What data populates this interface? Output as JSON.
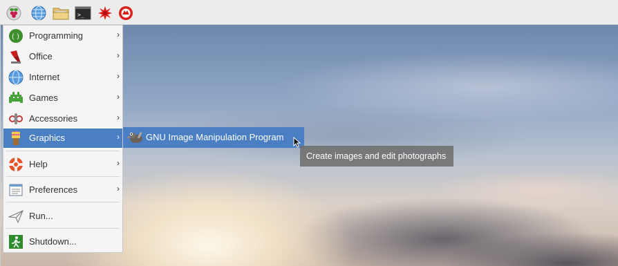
{
  "taskbar": {
    "icons": [
      {
        "name": "raspberry-menu-icon"
      },
      {
        "name": "web-browser-icon"
      },
      {
        "name": "file-manager-icon"
      },
      {
        "name": "terminal-icon"
      },
      {
        "name": "mathematica-icon"
      },
      {
        "name": "wolfram-icon"
      }
    ]
  },
  "menu": {
    "items": [
      {
        "label": "Programming",
        "icon": "programming-icon",
        "submenu": true
      },
      {
        "label": "Office",
        "icon": "office-icon",
        "submenu": true
      },
      {
        "label": "Internet",
        "icon": "internet-icon",
        "submenu": true
      },
      {
        "label": "Games",
        "icon": "games-icon",
        "submenu": true
      },
      {
        "label": "Accessories",
        "icon": "accessories-icon",
        "submenu": true
      },
      {
        "label": "Graphics",
        "icon": "graphics-icon",
        "submenu": true,
        "active": true
      },
      {
        "label": "Help",
        "icon": "help-icon",
        "submenu": true
      },
      {
        "label": "Preferences",
        "icon": "preferences-icon",
        "submenu": true
      },
      {
        "label": "Run...",
        "icon": "run-icon",
        "submenu": false
      },
      {
        "label": "Shutdown...",
        "icon": "shutdown-icon",
        "submenu": false
      }
    ],
    "arrow": "›"
  },
  "submenu": {
    "items": [
      {
        "label": "GNU Image Manipulation Program",
        "icon": "gimp-icon"
      }
    ]
  },
  "tooltip": {
    "text": "Create images and edit photographs"
  },
  "colors": {
    "highlight": "#4a7fc4",
    "menu_bg": "#f5f5f5",
    "taskbar_bg": "#ededed"
  }
}
